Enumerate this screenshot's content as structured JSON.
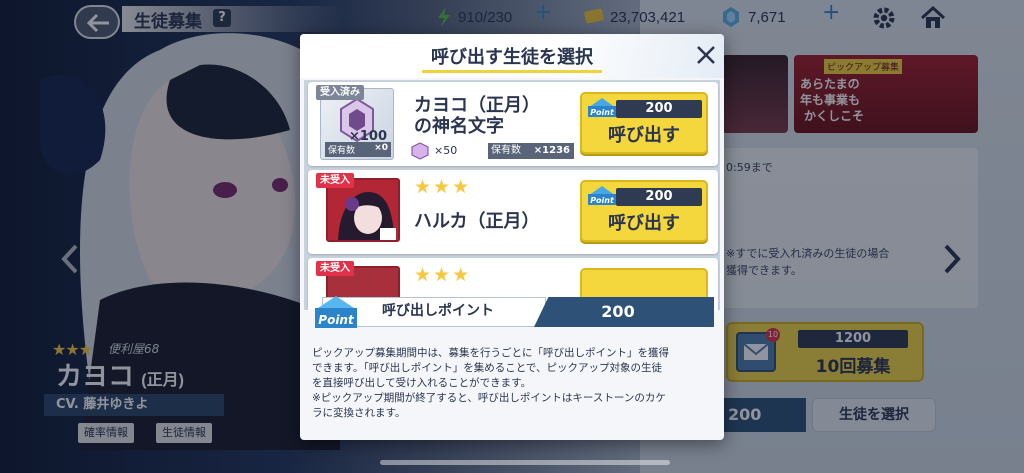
{
  "topbar": {
    "title": "生徒募集",
    "help_icon_text": "?",
    "ap": "910/230",
    "credits": "23,703,421",
    "gems": "7,671"
  },
  "character": {
    "stars": "★★★",
    "club": "便利屋68",
    "name": "カヨコ",
    "name_suffix": "(正月)",
    "cv": "CV. 藤井ゆきよ",
    "rate_info": "確率情報",
    "student_info": "生徒情報"
  },
  "background_panel": {
    "countdown": "0:59まで",
    "notice_line1": "※すでに受入れ済みの生徒の場合",
    "notice_line2": "獲得できます。",
    "banner_text": [
      "あらたまの",
      "年も事業も",
      "かくしこそ"
    ],
    "banner_badge": "ピックアップ募集",
    "recruit10_cost": "1200",
    "recruit10_label": "10回募集",
    "ticket_count": "10",
    "points_value": "200",
    "select_student": "生徒を選択"
  },
  "modal": {
    "title": "呼び出す生徒を選択",
    "items": [
      {
        "tag": "受入済み",
        "thumb_qty": "×100",
        "thumb_own_label": "保有数",
        "thumb_own_value": "×0",
        "name_line1": "カヨコ（正月）",
        "name_line2": "の神名文字",
        "frag_qty": "×50",
        "frag_own_label": "保有数",
        "frag_own_value": "×1236",
        "cost": "200",
        "call_label": "呼び出す"
      },
      {
        "tag": "未受入",
        "stars": "★★★",
        "name": "ハルカ（正月）",
        "cost": "200",
        "call_label": "呼び出す"
      },
      {
        "tag": "未受入",
        "stars": "★★★"
      }
    ],
    "point_badge": "Point",
    "points_label": "呼び出しポイント",
    "points_value": "200",
    "description": [
      "ピックアップ募集期間中は、募集を行うごとに「呼び出しポイント」を獲得",
      "できます。「呼び出しポイント」を集めることで、ピックアップ対象の生徒",
      "を直接呼び出して受け入れることができます。",
      "※ピックアップ期間が終了すると、呼び出しポイントはキーストーンのカケ",
      "ラに変換されます。"
    ]
  },
  "colors": {
    "accent_yellow": "#f4d63d",
    "navy": "#2b3550",
    "points_blue": "#2e5277",
    "tag_red": "#e2314a"
  }
}
